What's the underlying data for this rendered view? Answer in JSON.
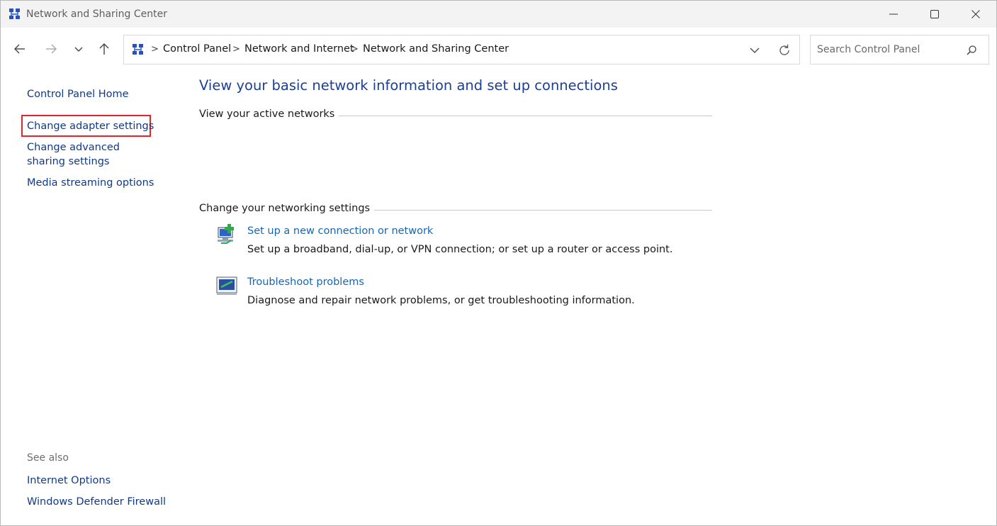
{
  "window": {
    "title": "Network and Sharing Center"
  },
  "address_bar": {
    "breadcrumbs": [
      "Control Panel",
      "Network and Internet",
      "Network and Sharing Center"
    ],
    "separator": ">"
  },
  "search": {
    "placeholder": "Search Control Panel"
  },
  "left_pane": {
    "links": [
      "Control Panel Home",
      "Change adapter settings",
      "Change advanced sharing settings",
      "Media streaming options"
    ],
    "see_also_label": "See also",
    "see_also_links": [
      "Internet Options",
      "Windows Defender Firewall"
    ]
  },
  "main": {
    "heading": "View your basic network information and set up connections",
    "active_networks_label": "View your active networks",
    "networking_settings_label": "Change your networking settings",
    "tasks": [
      {
        "icon": "new-connection-icon",
        "link": "Set up a new connection or network",
        "description": "Set up a broadband, dial-up, or VPN connection; or set up a router or access point."
      },
      {
        "icon": "troubleshoot-icon",
        "link": "Troubleshoot problems",
        "description": "Diagnose and repair network problems, or get troubleshooting information."
      }
    ]
  },
  "colors": {
    "link": "#0f3a8a",
    "heading": "#1b3f95",
    "task_link": "#1566b8",
    "highlight": "#e0252b",
    "titlebar": "#f3f3f3"
  }
}
